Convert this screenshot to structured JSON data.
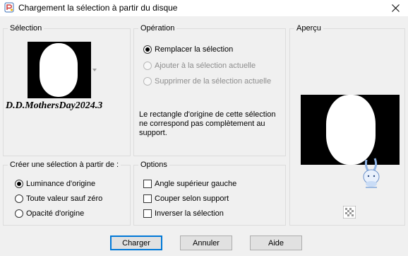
{
  "window": {
    "title": "Chargement la sélection à partir du disque",
    "icon": "psp-app-icon",
    "close_icon": "close-icon"
  },
  "selection_group": {
    "legend": "Sélection",
    "file_name": "D.D.MothersDay2024.3",
    "thumbnail_icon": "white-oval-on-black-thumbnail"
  },
  "operation_group": {
    "legend": "Opération",
    "options": [
      {
        "label": "Remplacer la sélection",
        "checked": true,
        "enabled": true
      },
      {
        "label": "Ajouter à la sélection actuelle",
        "checked": false,
        "enabled": false
      },
      {
        "label": "Supprimer de la sélection actuelle",
        "checked": false,
        "enabled": false
      }
    ],
    "message": "Le rectangle d'origine de cette sélection ne correspond pas complètement au support."
  },
  "create_from_group": {
    "legend": "Créer une sélection à partir de :",
    "options": [
      {
        "label": "Luminance d'origine",
        "checked": true
      },
      {
        "label": "Toute valeur sauf zéro",
        "checked": false
      },
      {
        "label": "Opacité d'origine",
        "checked": false
      }
    ]
  },
  "options_group": {
    "legend": "Options",
    "checkboxes": [
      {
        "label": "Angle supérieur gauche",
        "checked": false
      },
      {
        "label": "Couper selon support",
        "checked": false
      },
      {
        "label": "Inverser la sélection",
        "checked": false
      }
    ]
  },
  "preview_group": {
    "legend": "Aperçu",
    "preview_icon": "white-oval-on-black-preview",
    "mascot_icon": "bunny-mascot-icon",
    "checker_icon": "transparency-checker-icon"
  },
  "buttons": {
    "load": "Charger",
    "cancel": "Annuler",
    "help": "Aide"
  },
  "colors": {
    "background": "#f0f0f0",
    "accent": "#0078d7",
    "group_border": "#dcdcdc",
    "disabled_text": "#8d8d8d"
  }
}
